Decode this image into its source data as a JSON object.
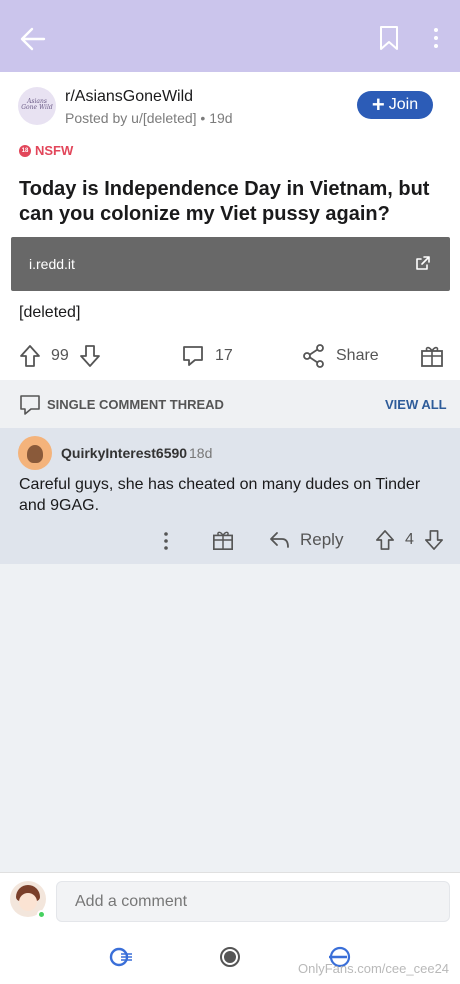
{
  "header": {
    "back_icon": "arrow-left-icon",
    "bookmark_icon": "bookmark-icon",
    "more_icon": "more-vertical-icon",
    "background": "#cbc5ec"
  },
  "post": {
    "subreddit": "r/AsiansGoneWild",
    "subreddit_avatar_text": "Asians Gone Wild",
    "posted_by": "Posted by u/[deleted] • 19d",
    "join_label": "Join",
    "join_color": "#2c5cb7",
    "nsfw_label": "NSFW",
    "nsfw_badge": "18",
    "nsfw_color": "#e2465a",
    "title": "Today is Independence Day in Vietnam, but can you colonize my Viet pussy again?",
    "link_domain": "i.redd.it",
    "body": "[deleted]",
    "upvotes": "99",
    "comments": "17",
    "share_label": "Share"
  },
  "thread": {
    "label": "SINGLE COMMENT THREAD",
    "view_all": "VIEW ALL"
  },
  "comment": {
    "username": "QuirkyInterest6590",
    "time": "18d",
    "text": "Careful guys, she has cheated on many dudes on Tinder and 9GAG.",
    "reply_label": "Reply",
    "votes": "4"
  },
  "composer": {
    "placeholder": "Add a comment"
  },
  "watermark": "OnlyFans.com/cee_cee24"
}
